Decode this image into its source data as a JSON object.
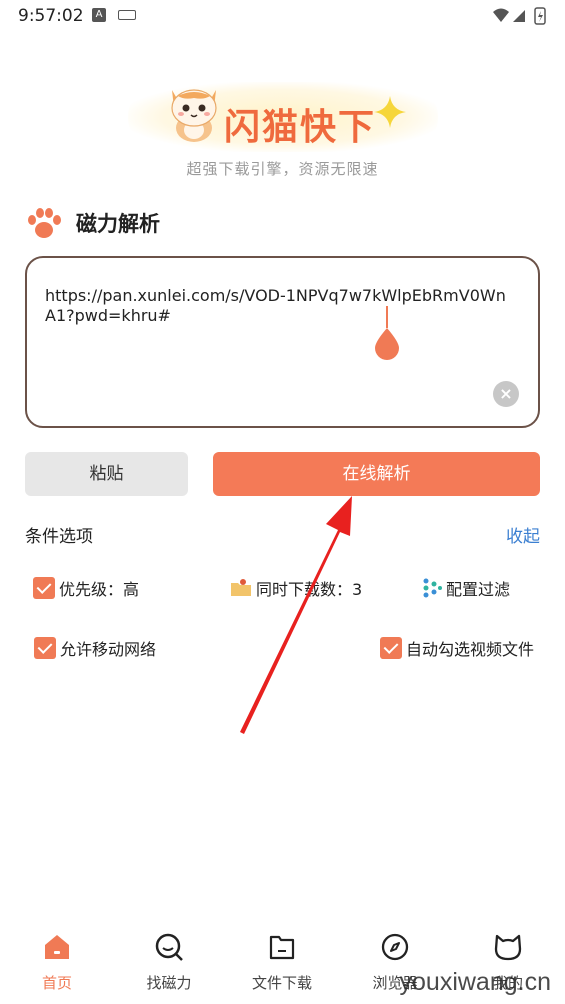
{
  "status_bar": {
    "time": "9:57:02"
  },
  "header": {
    "app_name": "闪猫快下",
    "subtitle": "超强下载引擎，资源无限速"
  },
  "section": {
    "title": "磁力解析"
  },
  "url_input": {
    "value": "https://pan.xunlei.com/s/VOD-1NPVq7w7kWlpEbRmV0WnA1?pwd=khru#"
  },
  "buttons": {
    "paste": "粘贴",
    "parse": "在线解析"
  },
  "options": {
    "title": "条件选项",
    "collapse": "收起",
    "priority": "优先级：高",
    "concurrent": "同时下载数：3",
    "filter": "配置过滤",
    "mobile_network": "允许移动网络",
    "auto_select_video": "自动勾选视频文件"
  },
  "nav": {
    "items": [
      {
        "label": "首页",
        "icon": "home-icon",
        "active": true
      },
      {
        "label": "找磁力",
        "icon": "search-icon",
        "active": false
      },
      {
        "label": "文件下载",
        "icon": "folder-icon",
        "active": false
      },
      {
        "label": "浏览器",
        "icon": "compass-icon",
        "active": false
      },
      {
        "label": "我的",
        "icon": "cat-face-icon",
        "active": false
      }
    ]
  },
  "watermark": "youxiwang.cn",
  "colors": {
    "accent": "#f47a57",
    "link": "#3b7fd1",
    "border": "#6b5248"
  }
}
